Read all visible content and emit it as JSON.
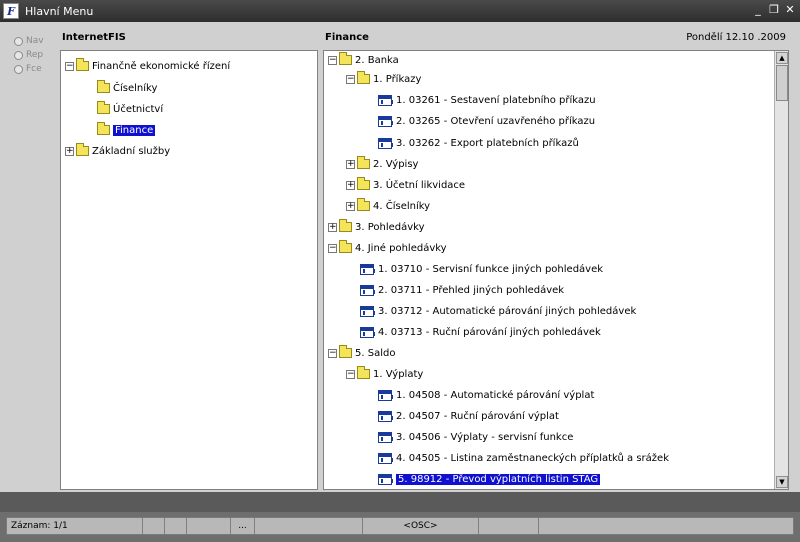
{
  "window": {
    "title": "Hlavní Menu",
    "icon": "ff-icon",
    "buttons": [
      "minimize-icon",
      "restore-icon",
      "close-icon"
    ]
  },
  "radios": [
    {
      "label": "Nav"
    },
    {
      "label": "Rep"
    },
    {
      "label": "Fce"
    }
  ],
  "left_panel": {
    "header": "InternetFIS",
    "items": [
      {
        "label": "Finančně ekonomické řízení",
        "expander": "−"
      },
      {
        "label": "Číselníky"
      },
      {
        "label": "Účetnictví"
      },
      {
        "label": "Finance",
        "selected": true
      },
      {
        "label": "Základní služby",
        "expander": "+"
      }
    ]
  },
  "right_panel": {
    "header": "Finance",
    "date": "Pondělí 12.10 .2009",
    "items": [
      {
        "label": "2. Banka",
        "expander": "−",
        "icon": "folder"
      },
      {
        "label": "1. Příkazy",
        "expander": "−",
        "icon": "folder"
      },
      {
        "label": "1.  03261 - Sestavení platebního příkazu",
        "icon": "doc"
      },
      {
        "label": "2.  03265 - Otevření uzavřeného příkazu",
        "icon": "doc"
      },
      {
        "label": "3.  03262 - Export platebních příkazů",
        "icon": "doc"
      },
      {
        "label": "2. Výpisy",
        "expander": "+",
        "icon": "folder"
      },
      {
        "label": "3. Účetní likvidace",
        "expander": "+",
        "icon": "folder"
      },
      {
        "label": "4. Číselníky",
        "expander": "+",
        "icon": "folder"
      },
      {
        "label": "3. Pohledávky",
        "expander": "+",
        "icon": "folder"
      },
      {
        "label": "4. Jiné pohledávky",
        "expander": "−",
        "icon": "folder"
      },
      {
        "label": "1.  03710 - Servisní funkce jiných pohledávek",
        "icon": "doc"
      },
      {
        "label": "2.  03711 - Přehled jiných pohledávek",
        "icon": "doc"
      },
      {
        "label": "3.  03712 - Automatické párování jiných pohledávek",
        "icon": "doc"
      },
      {
        "label": "4.  03713 - Ruční párování jiných pohledávek",
        "icon": "doc"
      },
      {
        "label": "5. Saldo",
        "expander": "−",
        "icon": "folder"
      },
      {
        "label": "1. Výplaty",
        "expander": "−",
        "icon": "folder"
      },
      {
        "label": "1.  04508 - Automatické párování výplat",
        "icon": "doc"
      },
      {
        "label": "2.  04507 - Ruční párování výplat",
        "icon": "doc"
      },
      {
        "label": "3.  04506 - Výplaty - servisní funkce",
        "icon": "doc"
      },
      {
        "label": "4.  04505 - Listina zaměstnaneckých příplatků a srážek",
        "icon": "doc"
      },
      {
        "label": "5.  98912 - Převod výplatních listin STAG",
        "icon": "doc",
        "selected": true
      }
    ]
  },
  "status": {
    "record": "Záznam: 1/1",
    "dots": "...",
    "mode": "<OSC>"
  }
}
